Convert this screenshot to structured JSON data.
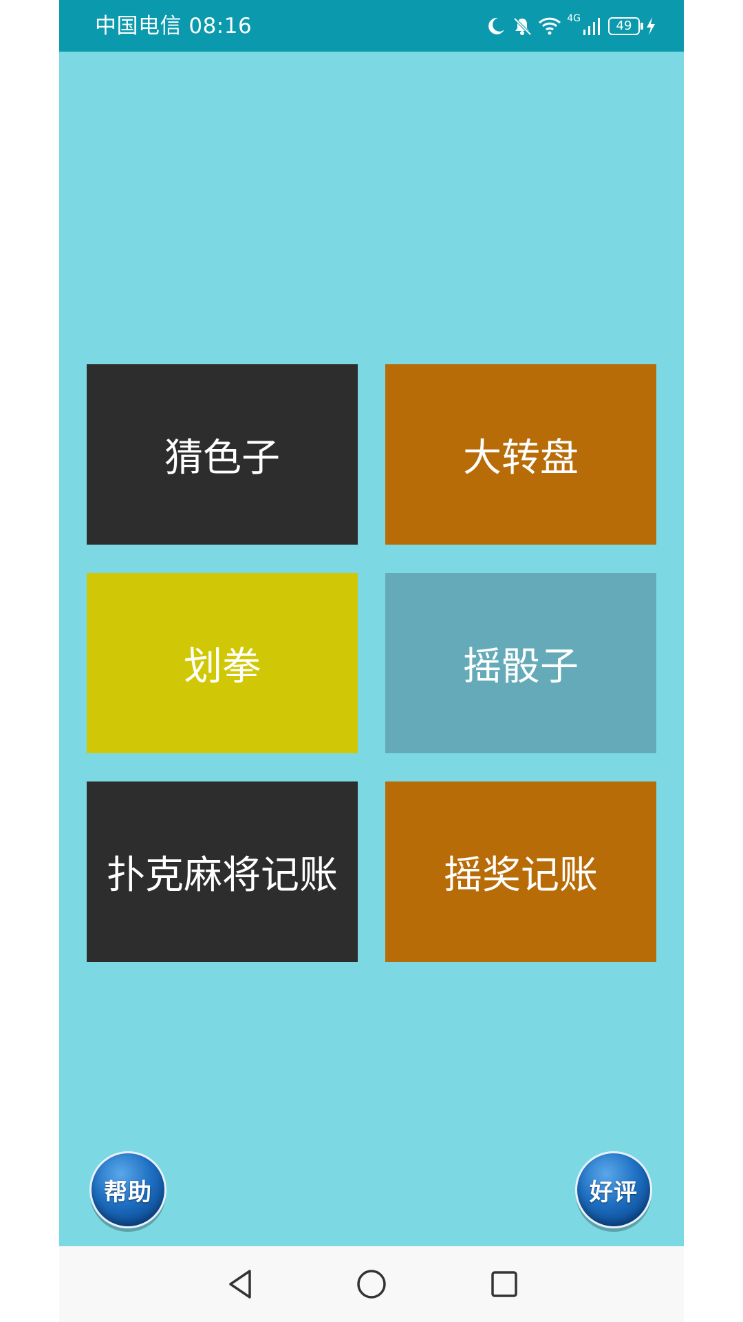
{
  "status_bar": {
    "carrier_time": "中国电信 08:16",
    "network": "4G",
    "battery": "49",
    "icons": [
      "moon-icon",
      "bell-muted-icon",
      "wifi-icon",
      "signal-icon",
      "battery-icon",
      "charging-icon"
    ]
  },
  "tiles": [
    {
      "label": "猜色子",
      "color": "#2d2d2d"
    },
    {
      "label": "大转盘",
      "color": "#b86c08"
    },
    {
      "label": "划拳",
      "color": "#d0c807"
    },
    {
      "label": "摇骰子",
      "color": "#64aab9"
    },
    {
      "label": "扑克麻将记账",
      "color": "#2d2d2d"
    },
    {
      "label": "摇奖记账",
      "color": "#b86c08"
    }
  ],
  "bottom_buttons": {
    "help_label": "帮助",
    "review_label": "好评"
  },
  "nav_bar": {
    "icons": [
      "back-icon",
      "home-icon",
      "recents-icon"
    ]
  },
  "colors": {
    "background": "#7cd8e2",
    "status_bar": "#0b9aad",
    "button_blue": "#1e6fc2"
  }
}
